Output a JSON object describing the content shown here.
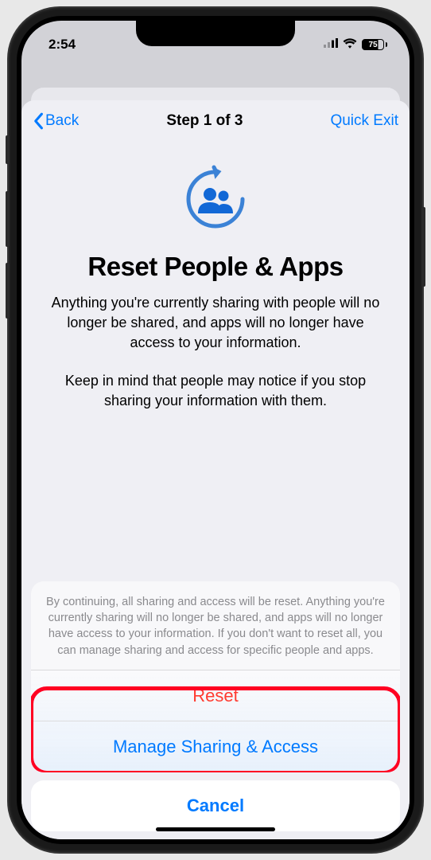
{
  "status": {
    "time": "2:54",
    "battery_pct": "75"
  },
  "nav": {
    "back_label": "Back",
    "step_label": "Step 1 of 3",
    "quick_exit": "Quick Exit"
  },
  "hero": {
    "title": "Reset People & Apps",
    "body": "Anything you're currently sharing with people will no longer be shared, and apps will no longer have access to your information.",
    "note": "Keep in mind that people may notice if you stop sharing your information with them."
  },
  "sheet": {
    "message": "By continuing, all sharing and access will be reset. Anything you're currently sharing will no longer be shared, and apps will no longer have access to your information. If you don't want to reset all, you can manage sharing and access for specific people and apps.",
    "reset_label": "Reset",
    "manage_label": "Manage Sharing & Access",
    "cancel_label": "Cancel"
  },
  "colors": {
    "ios_blue": "#007aff",
    "ios_red": "#ff3b30",
    "highlight": "#ff0022"
  }
}
